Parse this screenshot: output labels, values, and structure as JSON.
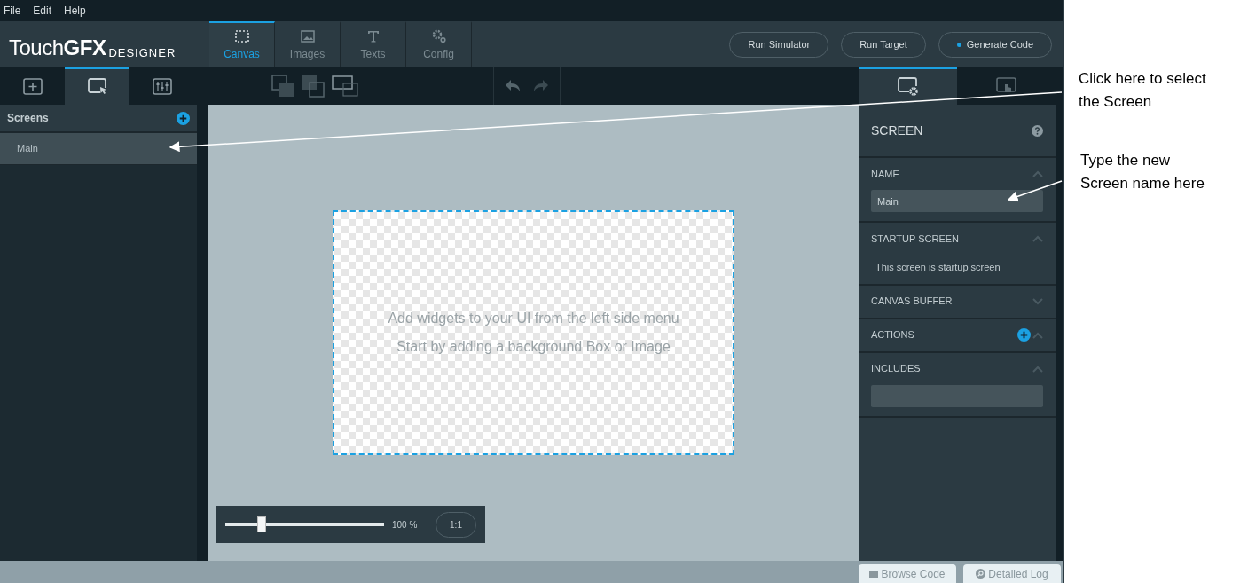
{
  "menu": [
    "File",
    "Edit",
    "Help"
  ],
  "logo": {
    "name": "Touch**GFX**",
    "product": "DESIGNER"
  },
  "main_tabs": [
    {
      "label": "Canvas",
      "kind": "canvas",
      "selected": true
    },
    {
      "label": "Images",
      "kind": "images",
      "selected": false
    },
    {
      "label": "Texts",
      "kind": "texts",
      "selected": false
    },
    {
      "label": "Config",
      "kind": "config",
      "selected": false
    }
  ],
  "actions": [
    {
      "label": "Run Simulator",
      "kind": "plain"
    },
    {
      "label": "Run Target",
      "kind": "plain"
    },
    {
      "label": "Generate Code",
      "kind": "dot"
    }
  ],
  "left_tabs": [
    {
      "kind": "add",
      "selected": false
    },
    {
      "kind": "screens",
      "selected": true
    },
    {
      "kind": "mixer",
      "selected": false
    }
  ],
  "right_tabs": [
    {
      "kind": "properties",
      "selected": true
    },
    {
      "kind": "interactions",
      "selected": false
    }
  ],
  "screens": {
    "title": "Screens",
    "items": [
      {
        "label": "Main",
        "selected": true
      }
    ]
  },
  "canvas": {
    "hints": [
      "Add widgets to your UI from the left side menu",
      "Start by adding a background Box or Image"
    ]
  },
  "zoom": {
    "level": 0.23,
    "reading": "100 %",
    "fit": "1:1"
  },
  "properties": {
    "title": "SCREEN",
    "sections": [
      {
        "kind": "field",
        "title": "NAME",
        "expanded": true,
        "value": "Main"
      },
      {
        "kind": "text",
        "title": "STARTUP SCREEN",
        "expanded": true,
        "text": "This screen is startup screen"
      },
      {
        "kind": "plain",
        "title": "CANVAS BUFFER",
        "expanded": false
      },
      {
        "kind": "add",
        "title": "ACTIONS",
        "expanded": true
      },
      {
        "kind": "empty_field",
        "title": "INCLUDES",
        "expanded": true
      }
    ]
  },
  "footer": [
    {
      "label": "Browse Code",
      "kind": "folder"
    },
    {
      "label": "Detailed Log",
      "kind": "log"
    }
  ],
  "annotations": [
    {
      "text": "Click here to select the Screen"
    },
    {
      "text": "Type the new Screen name here"
    }
  ]
}
